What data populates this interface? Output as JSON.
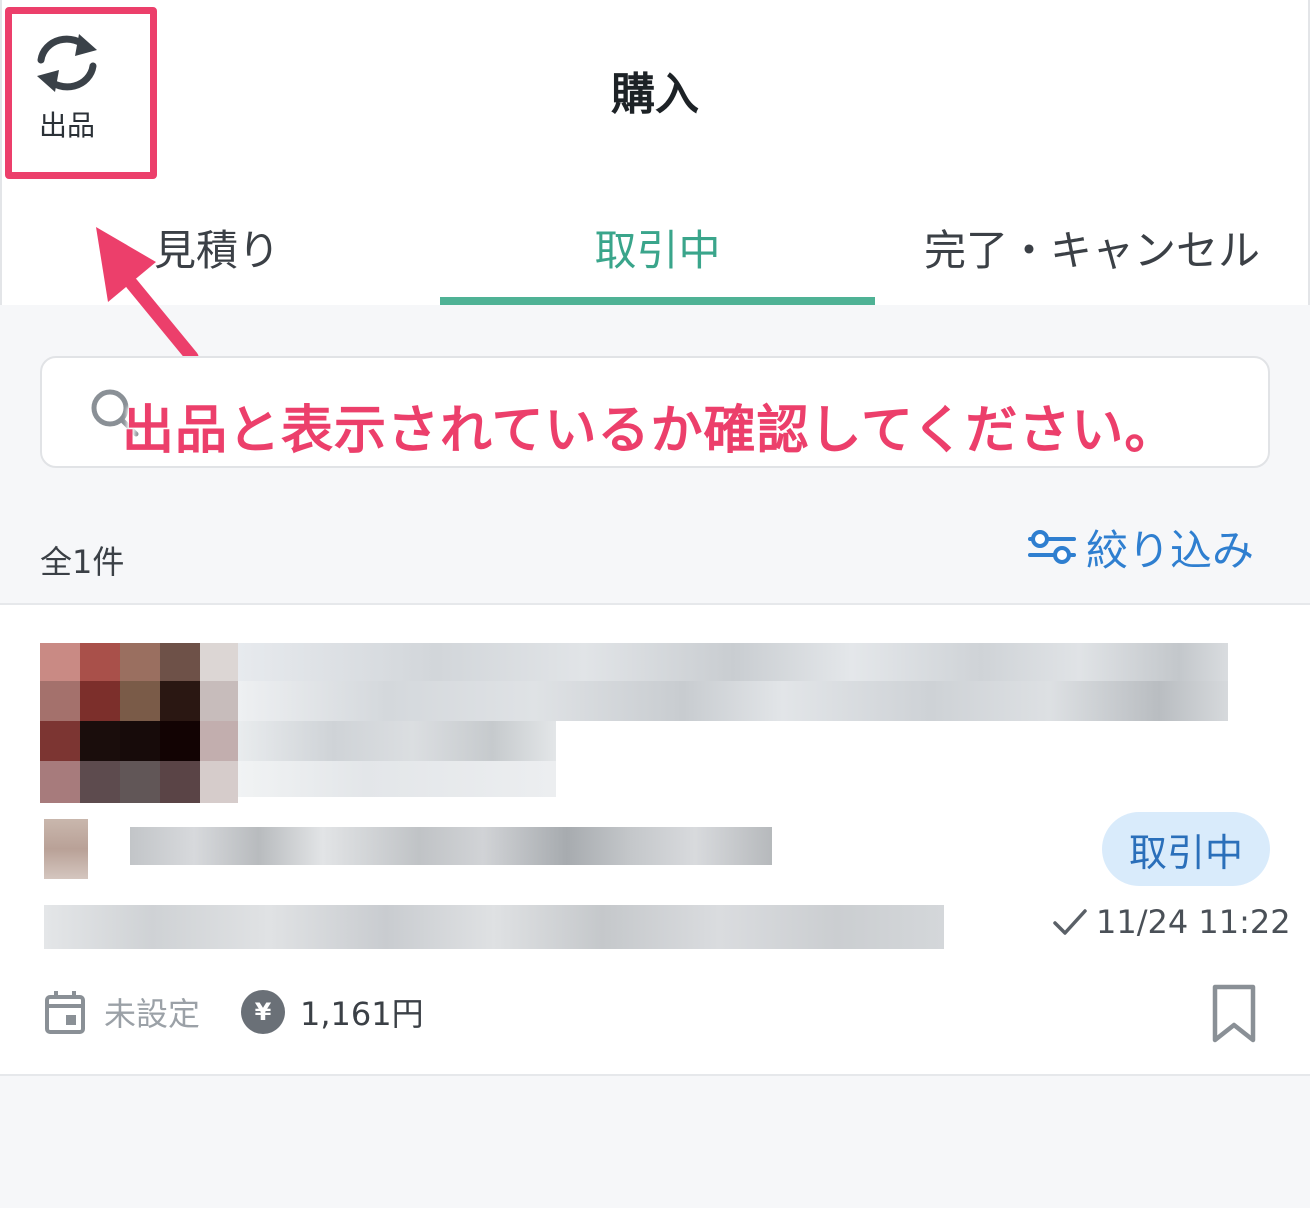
{
  "header": {
    "switch_label": "出品",
    "title": "購入"
  },
  "tabs": [
    {
      "label": "見積り",
      "active": false
    },
    {
      "label": "取引中",
      "active": true
    },
    {
      "label": "完了・キャンセル",
      "active": false
    }
  ],
  "search": {
    "placeholder": ""
  },
  "annotation": {
    "text": "出品と表示されているか確認してください。",
    "color": "#ec3f6b"
  },
  "list": {
    "count_label": "全1件",
    "filter_label": "絞り込み"
  },
  "item": {
    "status": "取引中",
    "date": "11/24 11:22",
    "delivery_date": "未設定",
    "price": "1,161円"
  },
  "icons": {
    "switch": "refresh-icon",
    "search": "search-icon",
    "filter": "sliders-icon",
    "check": "check-icon",
    "calendar": "calendar-icon",
    "yen": "yen-icon",
    "bookmark": "bookmark-icon"
  },
  "colors": {
    "accent_tab": "#4fb295",
    "filter_blue": "#2f7fd0",
    "badge_bg": "#d9ebfb",
    "highlight": "#ec3f6b"
  }
}
